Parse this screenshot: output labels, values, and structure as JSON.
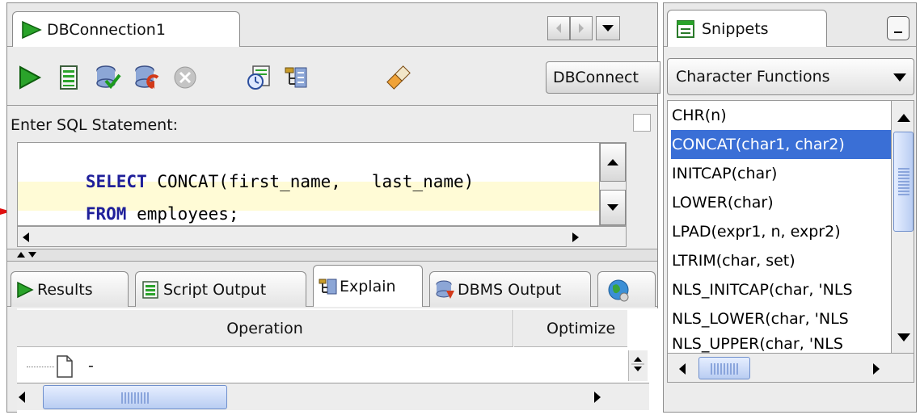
{
  "editor": {
    "tab_label": "DBConnection1",
    "connection_select": "DBConnect",
    "prompt_label": "Enter SQL Statement:",
    "sql": {
      "line1_keyword": "SELECT",
      "line1_rest": " CONCAT(first_name,   last_name)",
      "line2_keyword": "FROM",
      "line2_rest": " employees;"
    }
  },
  "toolbar": {
    "run_icon": "run-statement-icon",
    "script_icon": "run-script-icon",
    "commit_icon": "commit-icon",
    "rollback_icon": "rollback-icon",
    "cancel_icon": "cancel-icon",
    "history_icon": "sql-history-icon",
    "explain_icon": "explain-plan-icon",
    "clear_icon": "clear-eraser-icon"
  },
  "output_tabs": [
    "Results",
    "Script Output",
    "Explain",
    "DBMS Output"
  ],
  "explain_grid": {
    "columns": [
      "Operation",
      "Optimize"
    ],
    "rows": [
      {
        "operation": "-"
      }
    ]
  },
  "snippets": {
    "tab_label": "Snippets",
    "category": "Character Functions",
    "items": [
      "CHR(n)",
      "CONCAT(char1, char2)",
      "INITCAP(char)",
      "LOWER(char)",
      "LPAD(expr1, n, expr2)",
      "LTRIM(char, set)",
      "NLS_INITCAP(char, 'NLS",
      "NLS_LOWER(char, 'NLS",
      "NLS_UPPER(char, 'NLS"
    ],
    "selected_index": 1
  },
  "colors": {
    "selection": "#3a6fd6",
    "current_line": "#fffbd6",
    "keyword": "#1f1f9a",
    "arrow": "#e01010"
  }
}
